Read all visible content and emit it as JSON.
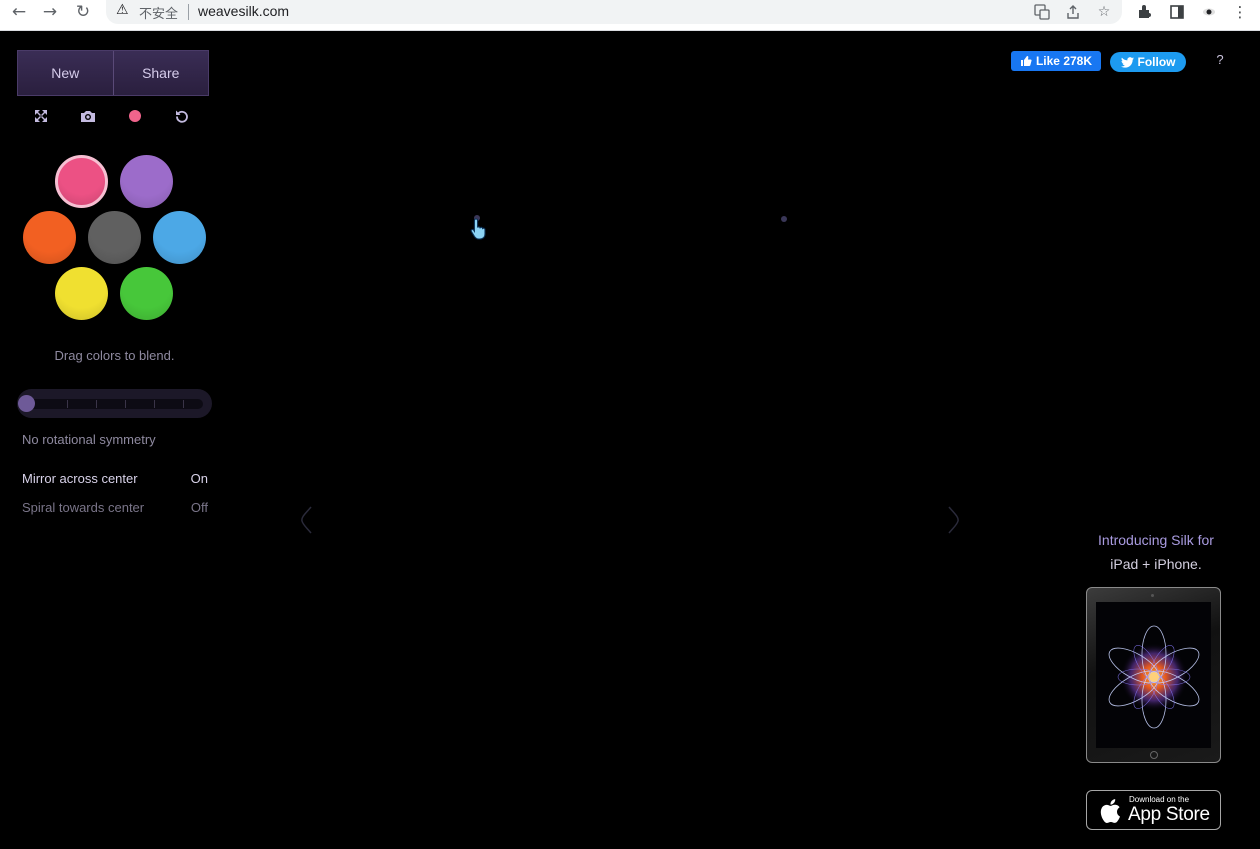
{
  "browser": {
    "back_icon": "arrow-left-icon",
    "forward_icon": "arrow-right-icon",
    "reload_icon": "reload-icon",
    "security_icon": "warning-triangle-icon",
    "security_label": "不安全",
    "url": "weavesilk.com",
    "omnibox_icons": [
      "translate-icon",
      "share-icon",
      "star-icon"
    ],
    "toolbar_icons": [
      "extensions-icon",
      "side-panel-icon",
      "profile-icon",
      "menu-icon"
    ]
  },
  "toolbar": {
    "new_label": "New",
    "share_label": "Share",
    "tools": [
      "fullscreen-icon",
      "camera-icon",
      "color-dot-icon",
      "undo-icon"
    ],
    "color_dot": "#f0648c"
  },
  "palette": {
    "colors": [
      {
        "name": "pink",
        "color": "#ec5184",
        "selected": true
      },
      {
        "name": "purple",
        "color": "#9c6cca",
        "selected": false
      },
      {
        "name": "orange",
        "color": "#f26022",
        "selected": false
      },
      {
        "name": "gray",
        "color": "#606060",
        "selected": false
      },
      {
        "name": "blue",
        "color": "#4ca8e6",
        "selected": false
      },
      {
        "name": "yellow",
        "color": "#f0e030",
        "selected": false
      },
      {
        "name": "green",
        "color": "#47c73a",
        "selected": false
      }
    ],
    "hint": "Drag colors to blend."
  },
  "symmetry": {
    "slider_level": 0,
    "label": "No rotational symmetry"
  },
  "options": {
    "mirror": {
      "label": "Mirror across center",
      "state": "On"
    },
    "spiral": {
      "label": "Spiral towards center",
      "state": "Off"
    }
  },
  "social": {
    "like_label": "Like 278K",
    "follow_label": "Follow",
    "help_label": "?"
  },
  "promo": {
    "line1": "Introducing Silk for",
    "line2": "iPad + iPhone.",
    "store_small": "Download on the",
    "store_big": "App Store"
  },
  "colors": {
    "accent_purple": "#3a2d55",
    "facebook_blue": "#1877f2",
    "twitter_blue": "#1d9bf0"
  }
}
